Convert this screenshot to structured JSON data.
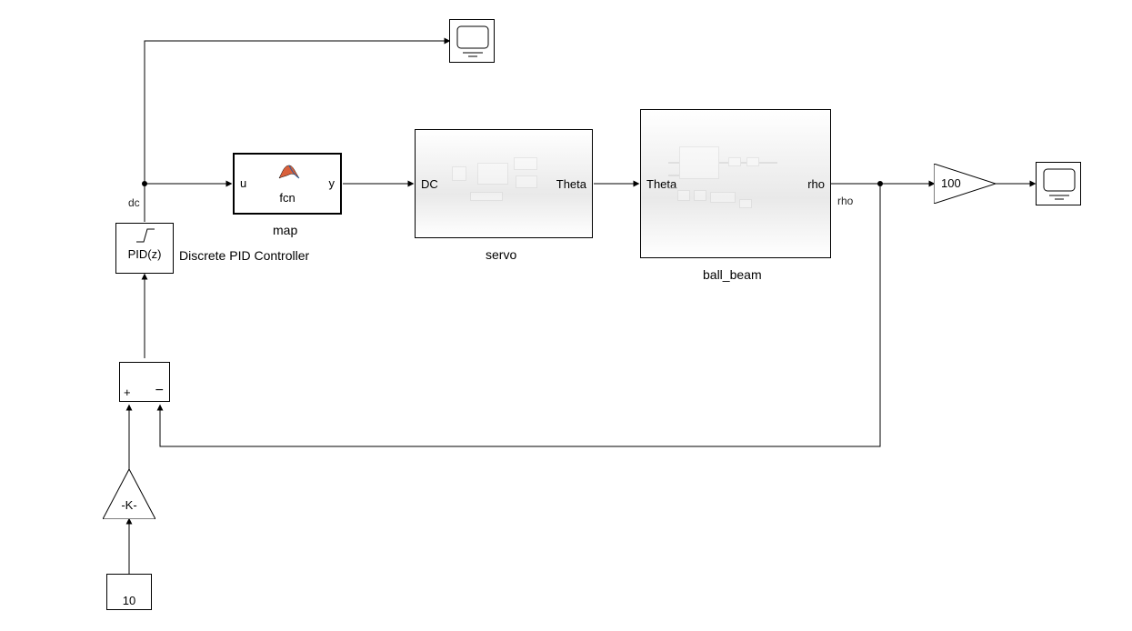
{
  "diagram": {
    "constant": {
      "value": "10"
    },
    "gainK": {
      "label": "-K-"
    },
    "gain100": {
      "label": "100"
    },
    "sum": {
      "plus": "+",
      "minus": "−"
    },
    "pid": {
      "label": "PID(z)",
      "name": "Discrete PID Controller"
    },
    "map": {
      "in": "u",
      "out": "y",
      "fcn": "fcn",
      "name": "map"
    },
    "servo": {
      "in": "DC",
      "out": "Theta",
      "name": "servo"
    },
    "ball_beam": {
      "in": "Theta",
      "out": "rho",
      "name": "ball_beam"
    },
    "signals": {
      "dc": "dc",
      "rho": "rho"
    }
  }
}
